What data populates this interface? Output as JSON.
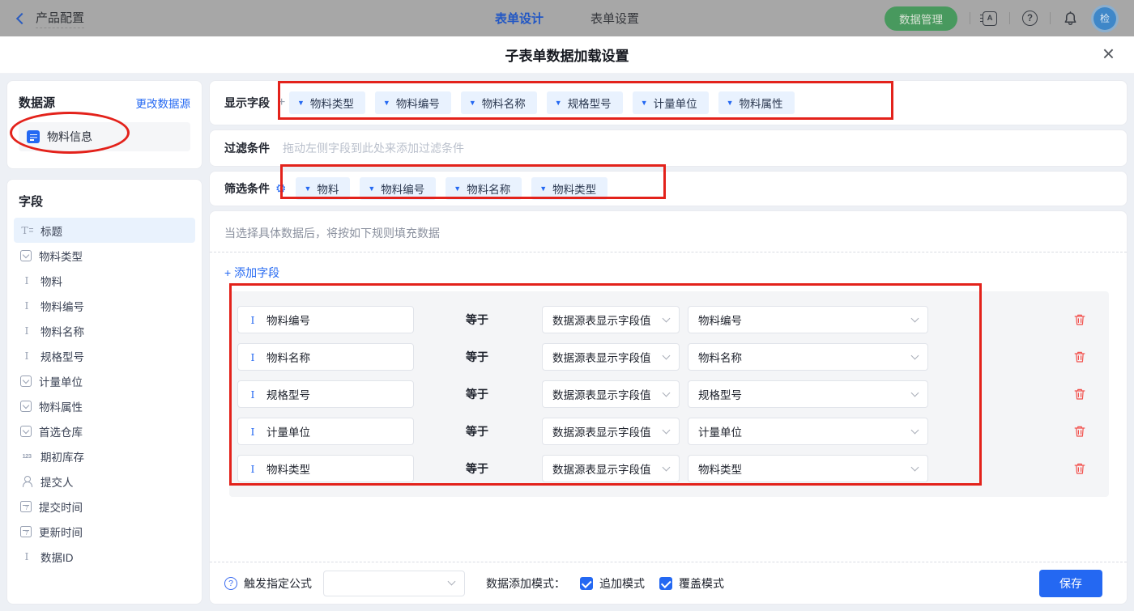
{
  "topbar": {
    "back_label": "产品配置",
    "tabs": [
      {
        "label": "表单设计",
        "active": true
      },
      {
        "label": "表单设置",
        "active": false
      }
    ],
    "data_manage_button": "数据管理",
    "icons": [
      "address-book-icon",
      "help-icon",
      "bell-icon"
    ],
    "avatar_text": "检"
  },
  "modal": {
    "title": "子表单数据加载设置",
    "close": "×"
  },
  "sidebar": {
    "datasource_title": "数据源",
    "change_datasource_link": "更改数据源",
    "datasource_item": {
      "label": "物料信息",
      "icon": "form-doc-icon"
    },
    "fields_title": "字段",
    "fields": [
      {
        "label": "标题",
        "icon": "title-icon",
        "state": "selected"
      },
      {
        "label": "物料类型",
        "icon": "select-icon"
      },
      {
        "label": "物料",
        "icon": "text-icon"
      },
      {
        "label": "物料编号",
        "icon": "text-icon"
      },
      {
        "label": "物料名称",
        "icon": "text-icon"
      },
      {
        "label": "规格型号",
        "icon": "text-icon"
      },
      {
        "label": "计量单位",
        "icon": "select-icon"
      },
      {
        "label": "物料属性",
        "icon": "select-icon"
      },
      {
        "label": "首选仓库",
        "icon": "select-icon"
      },
      {
        "label": "期初库存",
        "icon": "number-icon"
      },
      {
        "label": "提交人",
        "icon": "person-icon"
      },
      {
        "label": "提交时间",
        "icon": "calendar-icon"
      },
      {
        "label": "更新时间",
        "icon": "calendar-icon"
      },
      {
        "label": "数据ID",
        "icon": "text-icon"
      }
    ]
  },
  "main": {
    "display_fields": {
      "label": "显示字段",
      "add_symbol": "+",
      "tags": [
        "物料类型",
        "物料编号",
        "物料名称",
        "规格型号",
        "计量单位",
        "物料属性"
      ]
    },
    "filter_condition": {
      "label": "过滤条件",
      "placeholder": "拖动左侧字段到此处来添加过滤条件"
    },
    "screen_condition": {
      "label": "筛选条件",
      "tags": [
        "物料",
        "物料编号",
        "物料名称",
        "物料类型"
      ]
    },
    "rule_hint": "当选择具体数据后，将按如下规则填充数据",
    "add_field_link": "+ 添加字段",
    "mappings": [
      {
        "field": "物料编号",
        "operator": "等于",
        "source": "数据源表显示字段值",
        "target": "物料编号"
      },
      {
        "field": "物料名称",
        "operator": "等于",
        "source": "数据源表显示字段值",
        "target": "物料名称"
      },
      {
        "field": "规格型号",
        "operator": "等于",
        "source": "数据源表显示字段值",
        "target": "规格型号"
      },
      {
        "field": "计量单位",
        "operator": "等于",
        "source": "数据源表显示字段值",
        "target": "计量单位"
      },
      {
        "field": "物料类型",
        "operator": "等于",
        "source": "数据源表显示字段值",
        "target": "物料类型"
      }
    ]
  },
  "footer": {
    "formula_label": "触发指定公式",
    "formula_value": "",
    "mode_label": "数据添加模式：",
    "modes": [
      {
        "label": "追加模式",
        "checked": true
      },
      {
        "label": "覆盖模式",
        "checked": true
      }
    ],
    "save_button": "保存"
  },
  "colors": {
    "accent_blue": "#2468f2",
    "green_button": "#48995e",
    "annotation_red": "#e3221b",
    "trash_red": "#f2514d",
    "tag_bg": "#e9f2fe",
    "topbar_dimmed": "#a7a7a7"
  }
}
